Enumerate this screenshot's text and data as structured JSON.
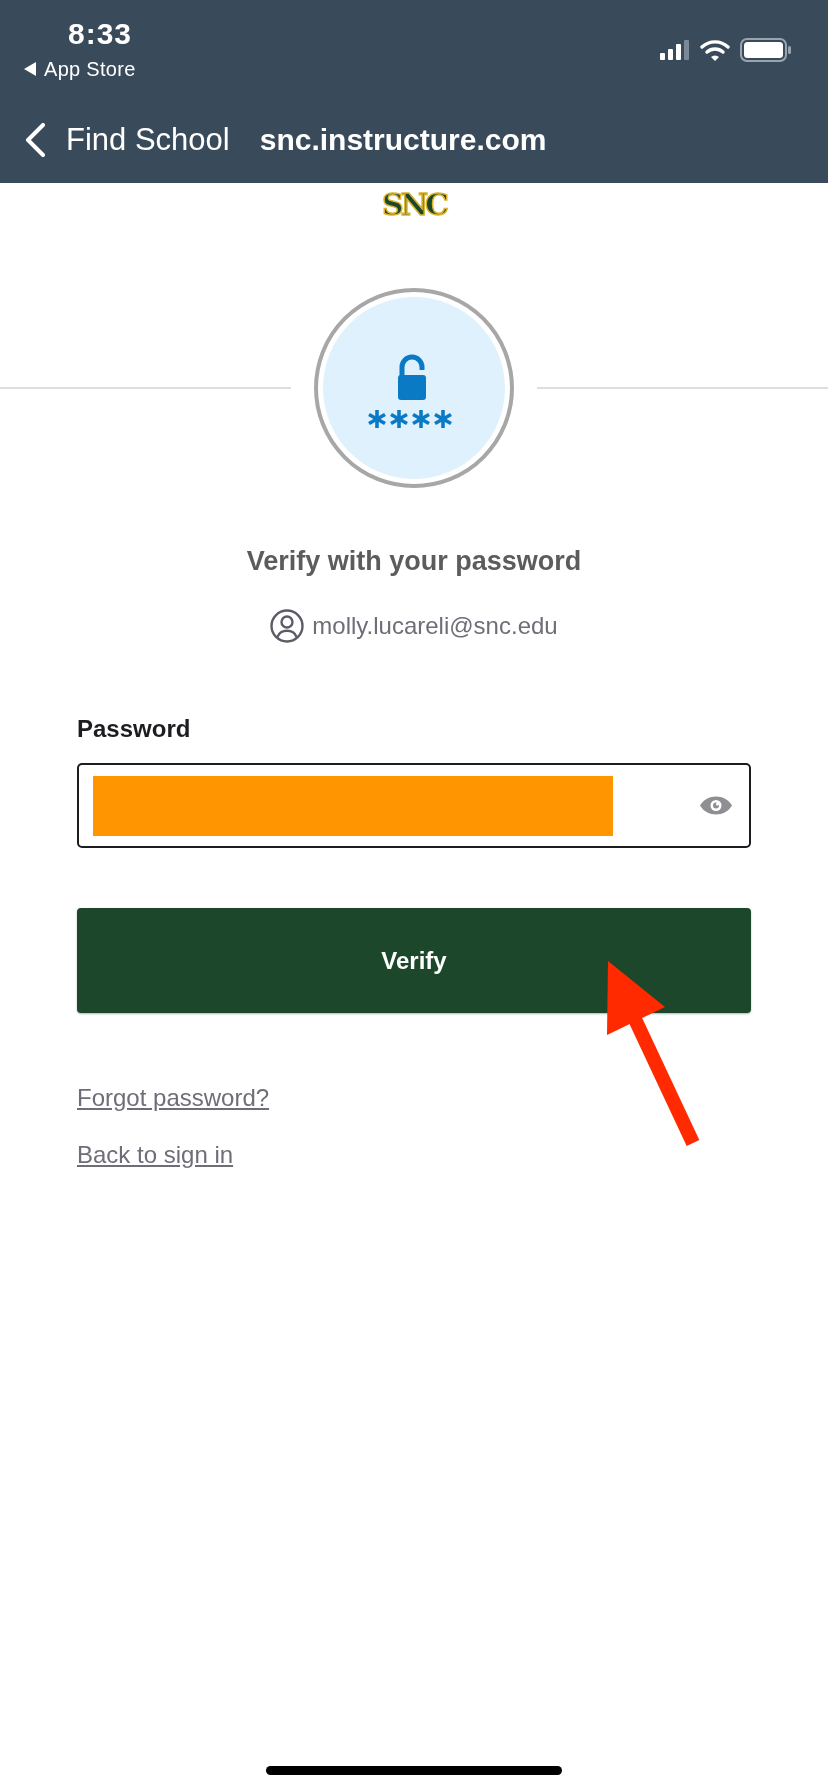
{
  "status_bar": {
    "time": "8:33",
    "back_app": "App Store"
  },
  "nav_bar": {
    "back_label": "Find School",
    "title": "snc.instructure.com"
  },
  "logo": {
    "text": "SNC"
  },
  "login": {
    "heading": "Verify with your password",
    "account": "molly.lucareli@snc.edu",
    "password": {
      "label": "Password",
      "redacted": true
    },
    "submit": "Verify",
    "links": [
      "Forgot password?",
      "Back to sign in"
    ]
  }
}
